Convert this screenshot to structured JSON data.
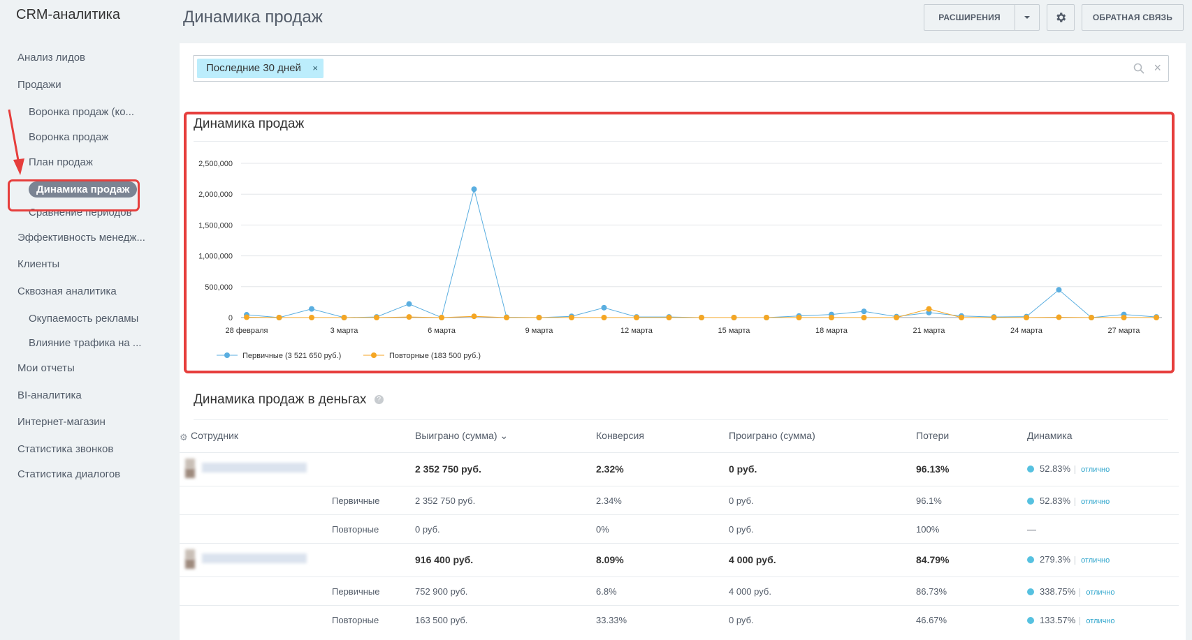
{
  "app_title": "CRM-аналитика",
  "page_title": "Динамика продаж",
  "nav": [
    {
      "label": "Анализ лидов",
      "level": 1
    },
    {
      "label": "Продажи",
      "level": 1
    },
    {
      "label": "Воронка продаж (ко...",
      "level": 2
    },
    {
      "label": "Воронка продаж",
      "level": 2
    },
    {
      "label": "План продаж",
      "level": 2
    },
    {
      "label": "Динамика продаж",
      "level": 2,
      "active": true
    },
    {
      "label": "Сравнение периодов",
      "level": 2
    },
    {
      "label": "Эффективность менедж...",
      "level": 1
    },
    {
      "label": "Клиенты",
      "level": 1
    },
    {
      "label": "Сквозная аналитика",
      "level": 1
    },
    {
      "label": "Окупаемость рекламы",
      "level": 2
    },
    {
      "label": "Влияние трафика на ...",
      "level": 2
    },
    {
      "label": "Мои отчеты",
      "level": 1
    },
    {
      "label": "BI-аналитика",
      "level": 1
    },
    {
      "label": "Интернет-магазин",
      "level": 1
    },
    {
      "label": "Статистика звонков",
      "level": 1
    },
    {
      "label": "Статистика диалогов",
      "level": 1
    }
  ],
  "header": {
    "extensions_label": "РАСШИРЕНИЯ",
    "feedback_label": "ОБРАТНАЯ СВЯЗЬ"
  },
  "filter": {
    "tag_label": "Последние 30 дней",
    "tag_remove": "×",
    "clear": "×"
  },
  "chart_section_title": "Динамика продаж",
  "chart_data": {
    "type": "line",
    "title": "",
    "xlabel": "",
    "ylabel": "",
    "ylim": [
      0,
      2500000
    ],
    "yticks": [
      0,
      500000,
      1000000,
      1500000,
      2000000,
      2500000
    ],
    "ytick_labels": [
      "0",
      "500,000",
      "1,000,000",
      "1,500,000",
      "2,000,000",
      "2,500,000"
    ],
    "x_count": 30,
    "x_tick_labels": [
      {
        "index": 0,
        "label": "28 февраля"
      },
      {
        "index": 3,
        "label": "3 марта"
      },
      {
        "index": 6,
        "label": "6 марта"
      },
      {
        "index": 9,
        "label": "9 марта"
      },
      {
        "index": 12,
        "label": "12 марта"
      },
      {
        "index": 15,
        "label": "15 марта"
      },
      {
        "index": 18,
        "label": "18 марта"
      },
      {
        "index": 21,
        "label": "21 марта"
      },
      {
        "index": 24,
        "label": "24 марта"
      },
      {
        "index": 27,
        "label": "27 марта"
      }
    ],
    "grid": true,
    "legend_position": "bottom-left",
    "series": [
      {
        "name": "Первичные (3 521 650 руб.)",
        "color": "#5aaee0",
        "values": [
          45000,
          0,
          140000,
          0,
          10000,
          220000,
          0,
          2080000,
          5000,
          0,
          20000,
          160000,
          10000,
          10000,
          0,
          0,
          0,
          25000,
          50000,
          100000,
          15000,
          80000,
          25000,
          10000,
          15000,
          450000,
          0,
          50000,
          10000
        ]
      },
      {
        "name": "Повторные (183 500 руб.)",
        "color": "#f5a623",
        "values": [
          5000,
          0,
          0,
          0,
          0,
          10000,
          0,
          20000,
          0,
          0,
          0,
          0,
          0,
          0,
          0,
          0,
          0,
          0,
          0,
          0,
          0,
          140000,
          0,
          0,
          0,
          5000,
          0,
          0,
          0
        ]
      }
    ]
  },
  "table_section_title": "Динамика продаж в деньгах",
  "table": {
    "headers": {
      "employee": "Сотрудник",
      "won": "Выиграно (сумма)",
      "conversion": "Конверсия",
      "lost": "Проиграно (сумма)",
      "losses": "Потери",
      "dynamics": "Динамика"
    },
    "rows": [
      {
        "kind": "main",
        "label": "",
        "won": "2 352 750 руб.",
        "conversion": "2.32%",
        "lost": "0 руб.",
        "losses": "96.13%",
        "dyn_value": "52.83%",
        "dyn_label": "отлично"
      },
      {
        "kind": "sub",
        "label": "Первичные",
        "won": "2 352 750 руб.",
        "conversion": "2.34%",
        "lost": "0 руб.",
        "losses": "96.1%",
        "dyn_value": "52.83%",
        "dyn_label": "отлично"
      },
      {
        "kind": "sub",
        "label": "Повторные",
        "won": "0 руб.",
        "conversion": "0%",
        "lost": "0 руб.",
        "losses": "100%",
        "dyn_value": "—",
        "dyn_label": ""
      },
      {
        "kind": "main",
        "label": "",
        "won": "916 400 руб.",
        "conversion": "8.09%",
        "lost": "4 000 руб.",
        "losses": "84.79%",
        "dyn_value": "279.3%",
        "dyn_label": "отлично"
      },
      {
        "kind": "sub",
        "label": "Первичные",
        "won": "752 900 руб.",
        "conversion": "6.8%",
        "lost": "4 000 руб.",
        "losses": "86.73%",
        "dyn_value": "338.75%",
        "dyn_label": "отлично"
      },
      {
        "kind": "sub",
        "label": "Повторные",
        "won": "163 500 руб.",
        "conversion": "33.33%",
        "lost": "0 руб.",
        "losses": "46.67%",
        "dyn_value": "133.57%",
        "dyn_label": "отлично"
      }
    ]
  },
  "colors": {
    "accent_red": "#e63e3c",
    "filter_tag_bg": "#bcedfc",
    "nav_active_bg": "#7b8493",
    "status_dot": "#56c1e0",
    "status_link": "#2fa5cc"
  }
}
